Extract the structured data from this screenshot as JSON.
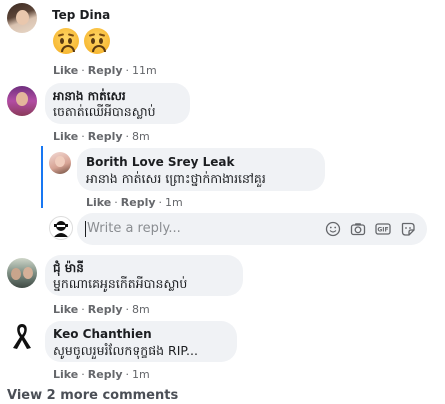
{
  "comments": [
    {
      "name": "Tep Dina",
      "text": "",
      "actions": {
        "like": "Like",
        "reply": "Reply",
        "time": "11m"
      }
    },
    {
      "name": "អានាង កាត់សេរ",
      "text": "ចេតាត់ឈើអីបានស្លាប់",
      "actions": {
        "like": "Like",
        "reply": "Reply",
        "time": "8m"
      }
    },
    {
      "name": "Borith Love Srey Leak",
      "text": "អានាង កាត់សេរ ព្រោះថ្នាក់កាងារនៅគួរ",
      "actions": {
        "like": "Like",
        "reply": "Reply",
        "time": "1m"
      }
    },
    {
      "name": "ជុំ ម៉ានី",
      "text": "ម្នកណាគេអូនកើតអីបានស្លាប់",
      "actions": {
        "like": "Like",
        "reply": "Reply",
        "time": "8m"
      }
    },
    {
      "name": "Keo Chanthien",
      "text": "សូមចូលរួមរំលែកទុក្ខផង RIP...",
      "actions": {
        "like": "Like",
        "reply": "Reply",
        "time": "1m"
      }
    }
  ],
  "reply_box": {
    "placeholder": "Write a reply..."
  },
  "icons": [
    "emoji-icon",
    "camera-icon",
    "gif-icon",
    "sticker-icon"
  ],
  "emoji": [
    "sad-face-icon",
    "sad-face-icon"
  ],
  "view_more": "View 2 more comments",
  "colors": {
    "bubble": "#f0f2f5",
    "thread": "#1877f2",
    "secondary_text": "#65676b"
  }
}
